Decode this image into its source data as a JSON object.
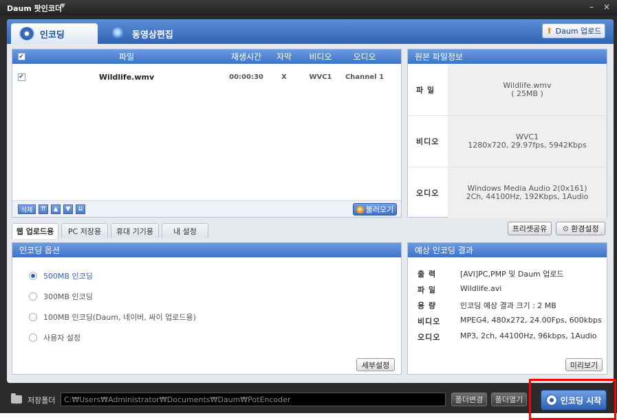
{
  "titlebar": {
    "title": "Daum 팟인코더",
    "caret": "▼",
    "minimize": "–",
    "close": "×"
  },
  "main_tabs": [
    {
      "label": "인코딩",
      "active": true
    },
    {
      "label": "동영상편집",
      "active": false
    }
  ],
  "daum_upload_button": "Daum 업로드",
  "file_list": {
    "columns": [
      "파일",
      "재생시간",
      "자막",
      "비디오",
      "오디오"
    ],
    "rows": [
      {
        "checked": true,
        "file": "Wildlife.wmv",
        "duration": "00:00:30",
        "subtitle": "X",
        "video": "WVC1",
        "audio": "Channel 1"
      }
    ],
    "delete_button": "삭제",
    "load_button": "불러오기"
  },
  "source_info": {
    "title": "원본 파일정보",
    "rows": [
      {
        "label": "파 일",
        "line1": "Wildlife.wmv",
        "line2": "( 25MB )"
      },
      {
        "label": "비디오",
        "line1": "WVC1",
        "line2": "1280x720, 29.97fps, 5942Kbps"
      },
      {
        "label": "오디오",
        "line1": "Windows Media Audio 2(0x161)",
        "line2": "2Ch, 44100Hz, 192Kbps, 1Audio"
      }
    ]
  },
  "sub_tabs": [
    {
      "label": "웹 업로드용",
      "active": true
    },
    {
      "label": "PC 저장용",
      "active": false
    },
    {
      "label": "휴대 기기용",
      "active": false
    },
    {
      "label": "내 설정",
      "active": false
    }
  ],
  "preset_share_button": "프리셋공유",
  "env_settings_button": "환경설정",
  "encoding_options": {
    "title": "인코딩 옵션",
    "options": [
      {
        "label": "500MB 인코딩",
        "selected": true
      },
      {
        "label": "300MB 인코딩",
        "selected": false
      },
      {
        "label": "100MB 인코딩(Daum, 네이버, 싸이 업로드용)",
        "selected": false
      },
      {
        "label": "사용자 설정",
        "selected": false
      }
    ],
    "detail_button": "세부설정"
  },
  "expected_result": {
    "title": "예상 인코딩 결과",
    "rows": [
      {
        "label": "출 력",
        "value": "[AVI]PC,PMP 및 Daum 업로드"
      },
      {
        "label": "파 일",
        "value": "Wildlife.avi"
      },
      {
        "label": "용 량",
        "value": "인코딩 예상 결과 크기 : 2 MB"
      },
      {
        "label": "비디오",
        "value": "MPEG4, 480x272, 24.00Fps, 600kbps"
      },
      {
        "label": "오디오",
        "value": "MP3, 2ch, 44100Hz, 96kbps, 1Audio"
      }
    ],
    "preview_button": "미리보기"
  },
  "bottom_bar": {
    "save_folder_label": "저장폴더",
    "path": "C:₩Users₩Administrator₩Documents₩Daum₩PotEncoder",
    "change_folder_button": "폴더변경",
    "open_folder_button": "폴더열기",
    "start_button": "인코딩 시작"
  },
  "colors": {
    "accent": "#2f5fb3",
    "highlight": "#ff0000"
  }
}
